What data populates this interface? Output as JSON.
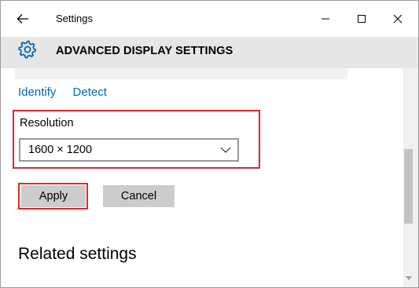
{
  "window": {
    "title": "Settings"
  },
  "header": {
    "title": "ADVANCED DISPLAY SETTINGS",
    "icon": "gear-icon",
    "accent_color": "#0067b8"
  },
  "links": {
    "identify": "Identify",
    "detect": "Detect"
  },
  "resolution": {
    "label": "Resolution",
    "value": "1600 × 1200"
  },
  "buttons": {
    "apply": "Apply",
    "cancel": "Cancel"
  },
  "related": {
    "heading": "Related settings"
  },
  "highlight_color": "#e0262a"
}
